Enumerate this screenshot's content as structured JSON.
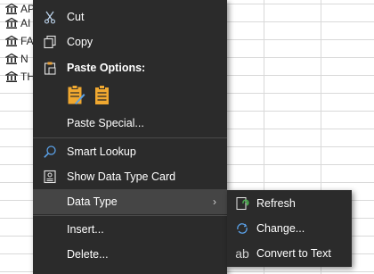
{
  "sheet": {
    "rows": [
      {
        "text": "APPLE INC"
      },
      {
        "text": "AI"
      },
      {
        "text": "FA"
      },
      {
        "text": "N"
      },
      {
        "text": "TH"
      }
    ]
  },
  "menu": {
    "cut": "Cut",
    "copy": "Copy",
    "paste_options": "Paste Options:",
    "paste_special": "Paste Special...",
    "smart_lookup": "Smart Lookup",
    "show_data_type_card": "Show Data Type Card",
    "data_type": "Data Type",
    "insert": "Insert...",
    "delete": "Delete..."
  },
  "submenu": {
    "refresh": "Refresh",
    "change": "Change...",
    "convert_to_text": "Convert to Text",
    "ab_glyph": "ab"
  }
}
